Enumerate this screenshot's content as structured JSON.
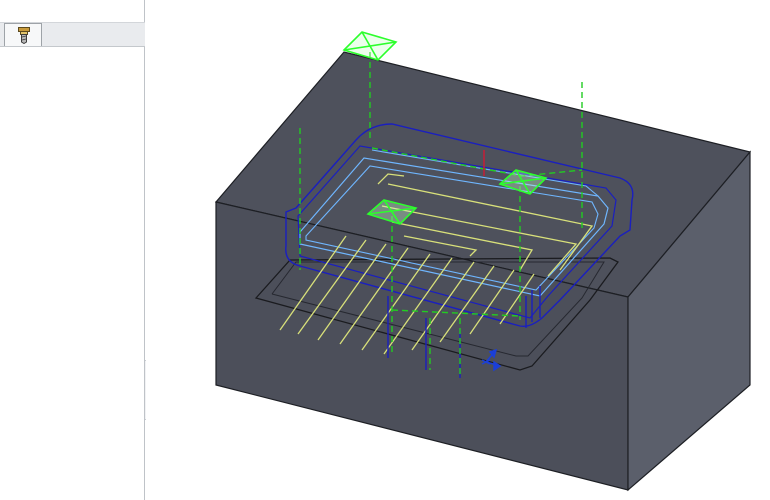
{
  "left_panel": {
    "toolbar": {
      "active_tab_icon": "cutting-tool-icon"
    }
  },
  "viewport": {
    "model": {
      "part": "block-with-pocket",
      "body_color": "#4e515c",
      "side_color": "#5a5e6a",
      "toolpath_colors": {
        "boundary": "#1a1fbf",
        "offset_pass": "#6fb6ff",
        "cut_pass": "#d8e07a",
        "rapid_move": "#22cc22",
        "entry_marker": "#2cff2c",
        "axis": "#1b3fd8"
      }
    }
  },
  "colors": {
    "panel_border": "#bfc3c8",
    "toolbar_bg": "#e9ebee"
  }
}
